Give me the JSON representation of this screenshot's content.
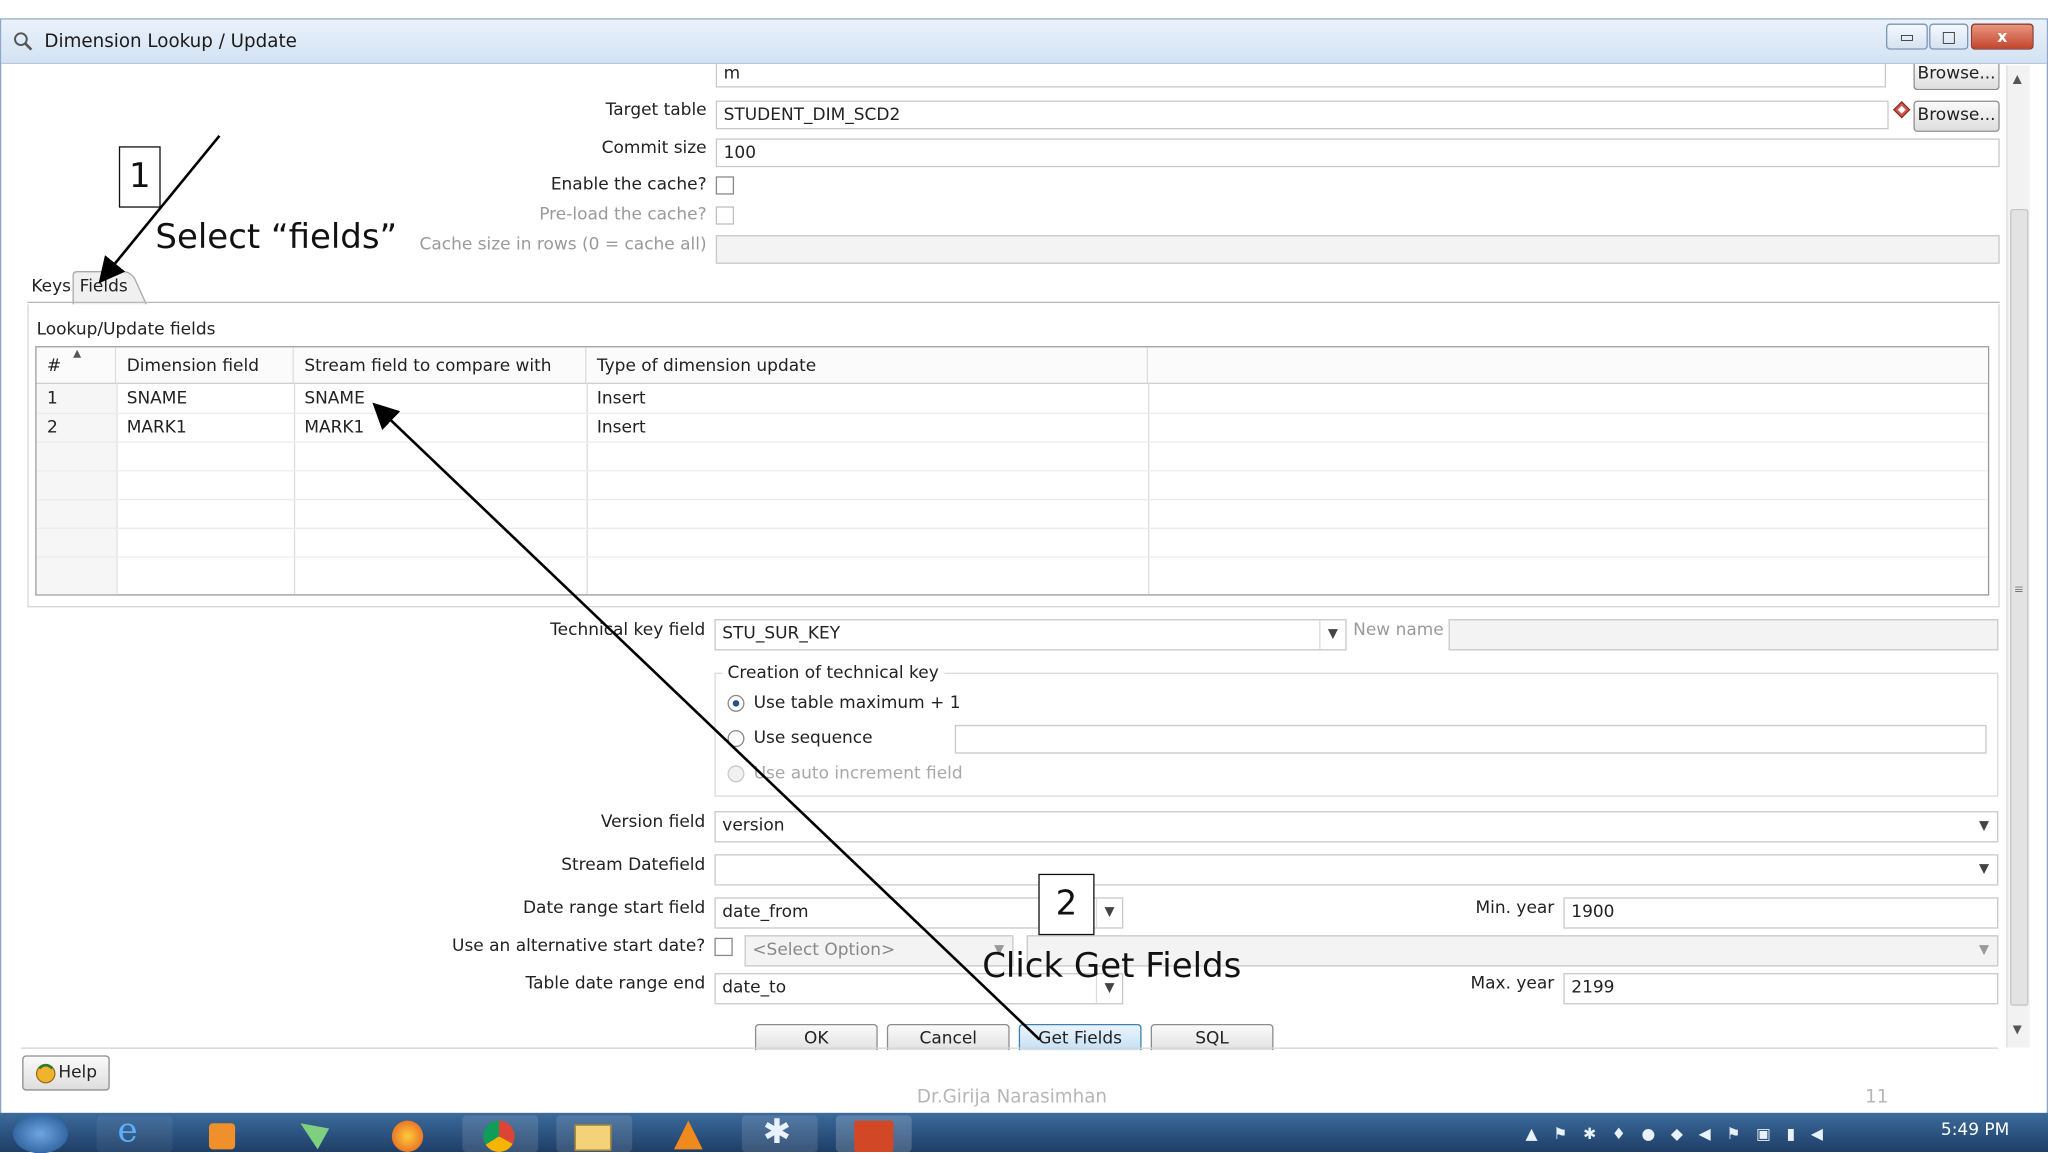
{
  "window": {
    "title": "Dimension Lookup / Update",
    "controls": {
      "minimize": "▭",
      "maximize": "□",
      "close": "x"
    }
  },
  "top": {
    "clipped_value": "m",
    "browse_label_top": "Browse...",
    "target_table_label": "Target table",
    "target_table_value": "STUDENT_DIM_SCD2",
    "browse_label": "Browse...",
    "commit_size_label": "Commit size",
    "commit_size_value": "100",
    "enable_cache_label": "Enable the cache?",
    "preload_cache_label": "Pre-load the cache?",
    "cache_size_label": "Cache size in rows (0 = cache all)"
  },
  "tabs": {
    "keys": "Keys",
    "fields": "Fields"
  },
  "grid": {
    "section_label": "Lookup/Update fields",
    "columns": [
      "#",
      "Dimension field",
      "Stream field to compare with",
      "Type of dimension update"
    ],
    "rows": [
      {
        "num": "1",
        "dimension_field": "SNAME",
        "stream_field": "SNAME",
        "update_type": "Insert"
      },
      {
        "num": "2",
        "dimension_field": "MARK1",
        "stream_field": "MARK1",
        "update_type": "Insert"
      }
    ]
  },
  "technical_key": {
    "label": "Technical key field",
    "value": "STU_SUR_KEY",
    "new_name_label": "New name",
    "creation_label": "Creation of technical key",
    "opt_table_max": "Use table maximum + 1",
    "opt_sequence": "Use sequence",
    "opt_auto_increment": "Use auto increment field"
  },
  "version": {
    "label": "Version field",
    "value": "version"
  },
  "stream_datefield": {
    "label": "Stream Datefield",
    "value": ""
  },
  "date_range": {
    "start_label": "Date range start field",
    "start_value": "date_from",
    "min_year_label": "Min. year",
    "min_year_value": "1900",
    "alt_start_label": "Use an alternative start date?",
    "alt_start_option": "<Select Option>",
    "end_label": "Table date range end",
    "end_value": "date_to",
    "max_year_label": "Max. year",
    "max_year_value": "2199"
  },
  "buttons": {
    "ok": "OK",
    "cancel": "Cancel",
    "get_fields": "Get Fields",
    "sql": "SQL",
    "help": "Help"
  },
  "annotations": {
    "step1_number": "1",
    "step1_text": "Select “fields”",
    "step2_number": "2",
    "step2_text": "Click Get Fields"
  },
  "slide": {
    "author": "Dr.Girija Narasimhan",
    "page": "11"
  },
  "taskbar": {
    "time": "5:49 PM"
  },
  "colors": {
    "accent": "#2a4f8a",
    "taskbar": "#1e3e66"
  }
}
